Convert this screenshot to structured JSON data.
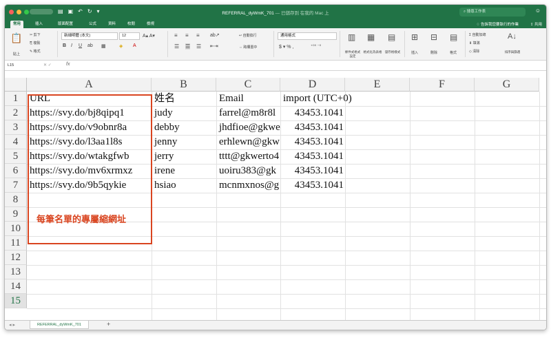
{
  "window": {
    "title": "REFERRAL_dyWmK_701",
    "title_suffix": " — 已儲存到 在我的 Mac 上",
    "search_placeholder": "搜尋工作表"
  },
  "tabs": [
    "常用",
    "插入",
    "版面配置",
    "公式",
    "資料",
    "校閱",
    "檢視"
  ],
  "active_tab": "常用",
  "tell_me": "告訴我您要執行的作業",
  "share": "共用",
  "ribbon": {
    "paste": "貼上",
    "cut": "剪下",
    "copy": "複製",
    "format_painter": "格式",
    "font_name": "新細明體 (本文)",
    "font_size": "12",
    "auto_wrap": "自動換行",
    "merge_center": "跨欄置中",
    "number_format": "通用格式",
    "conditional_format": "條件式格式設定",
    "format_as_table": "格式化為表格",
    "cell_styles": "儲存格樣式",
    "insert": "插入",
    "delete": "刪除",
    "format": "格式",
    "autosum": "自動加總",
    "fill": "填滿",
    "clear": "清除",
    "sort_filter": "排序與篩選"
  },
  "formula_bar": {
    "name_box": "L15",
    "fx": "fx"
  },
  "sheet": {
    "columns": [
      "A",
      "B",
      "C",
      "D",
      "E",
      "F",
      "G"
    ],
    "rows": [
      "1",
      "2",
      "3",
      "4",
      "5",
      "6",
      "7",
      "8",
      "9",
      "10",
      "11",
      "12",
      "13",
      "14",
      "15"
    ],
    "selected_row": "15",
    "header": [
      "URL",
      "姓名",
      "Email",
      "import (UTC+0)"
    ],
    "data": [
      [
        "https://svy.do/bj8qipq1",
        "judy",
        "farrel@m8r8l",
        "43453.1041"
      ],
      [
        "https://svy.do/v9obnr8a",
        "debby",
        "jhdfioe@gkwe",
        "43453.1041"
      ],
      [
        "https://svy.do/l3aa1l8s",
        "jenny",
        "erhlewn@gkw",
        "43453.1041"
      ],
      [
        "https://svy.do/wtakgfwb",
        "jerry",
        "tttt@gkwerto4",
        "43453.1041"
      ],
      [
        "https://svy.do/mv6xrmxz",
        "irene",
        "uoiru383@gk",
        "43453.1041"
      ],
      [
        "https://svy.do/9b5qykie",
        "hsiao",
        "mcnmxnos@g",
        "43453.1041"
      ]
    ]
  },
  "annotation": "每筆名單的專屬縮網址",
  "sheet_tab": "REFERRAL_dyWmK_701",
  "colors": {
    "excel_green": "#217346",
    "annotation_red": "#d9441f"
  }
}
